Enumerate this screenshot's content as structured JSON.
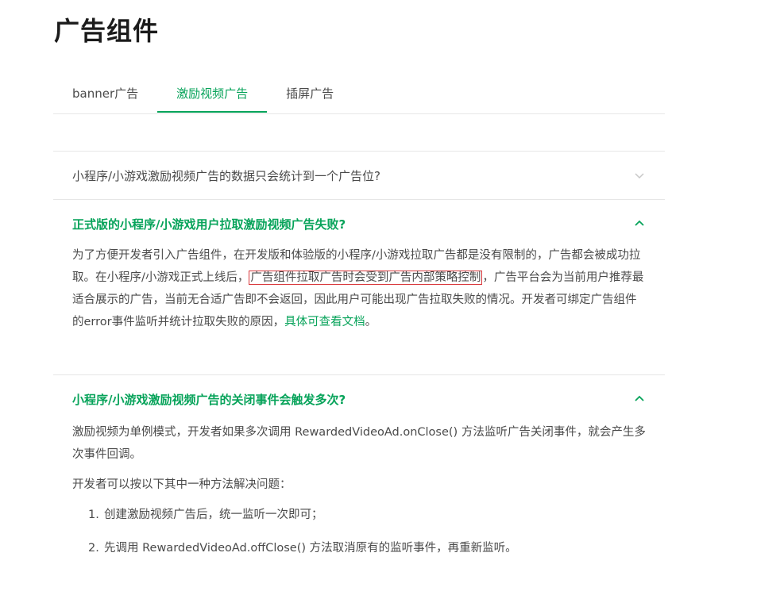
{
  "page": {
    "title": "广告组件"
  },
  "tabs": [
    {
      "label": "banner广告",
      "active": false
    },
    {
      "label": "激励视频广告",
      "active": true
    },
    {
      "label": "插屏广告",
      "active": false
    }
  ],
  "faq": {
    "q1": {
      "question": "小程序/小游戏激励视频广告的数据只会统计到一个广告位?",
      "expanded": false
    },
    "q2": {
      "question": "正式版的小程序/小游戏用户拉取激励视频广告失败?",
      "expanded": true,
      "answer_part1": "为了方便开发者引入广告组件，在开发版和体验版的小程序/小游戏拉取广告都是没有限制的，广告都会被成功拉取。在小程序/小游戏正式上线后，",
      "answer_highlight": "广告组件拉取广告时会受到广告内部策略控制",
      "answer_part2": "，广告平台会为当前用户推荐最适合展示的广告，当前无合适广告即不会返回，因此用户可能出现广告拉取失败的情况。开发者可绑定广告组件的error事件监听并统计拉取失败的原因，",
      "answer_link": "具体可查看文档",
      "answer_end": "。"
    },
    "q3": {
      "question": "小程序/小游戏激励视频广告的关闭事件会触发多次?",
      "expanded": true,
      "answer_p1": "激励视频为单例模式，开发者如果多次调用 RewardedVideoAd.onClose() 方法监听广告关闭事件，就会产生多次事件回调。",
      "answer_p2": "开发者可以按以下其中一种方法解决问题：",
      "steps": [
        {
          "num": "1.",
          "text": "创建激励视频广告后，统一监听一次即可；"
        },
        {
          "num": "2.",
          "text": "先调用 RewardedVideoAd.offClose() 方法取消原有的监听事件，再重新监听。"
        }
      ]
    }
  },
  "colors": {
    "accent": "#07a35a",
    "highlight_border": "#d9373b",
    "text": "#4a4a4a",
    "divider": "#e6e6e6"
  },
  "icons": {
    "collapsed": "chevron-down-icon",
    "expanded": "chevron-up-icon"
  }
}
